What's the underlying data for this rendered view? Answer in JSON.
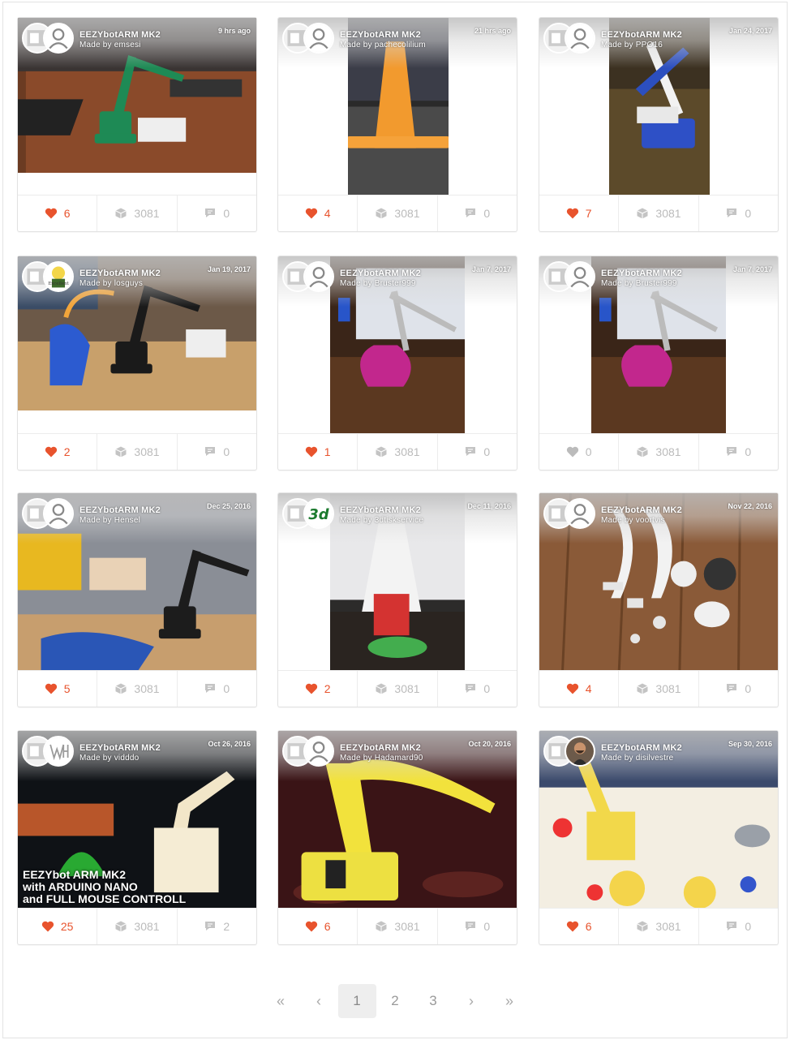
{
  "colors": {
    "accent": "#e8532d",
    "muted": "#bbbbbb"
  },
  "makes": [
    {
      "thing": "EEZYbotARM MK2",
      "maker": "Made by emsesi",
      "date": "9 hrs ago",
      "likes": "6",
      "views": "3081",
      "comments": "0",
      "liked": true,
      "avatar": "default-user-avatar"
    },
    {
      "thing": "EEZYbotARM MK2",
      "maker": "Made by pachecolilium",
      "date": "21 hrs ago",
      "likes": "4",
      "views": "3081",
      "comments": "0",
      "liked": true,
      "avatar": "default-user-avatar"
    },
    {
      "thing": "EEZYbotARM MK2",
      "maker": "Made by PPO16",
      "date": "Jan 24, 2017",
      "likes": "7",
      "views": "3081",
      "comments": "0",
      "liked": true,
      "avatar": "default-user-avatar"
    },
    {
      "thing": "EEZYbotARM MK2",
      "maker": "Made by losguys",
      "date": "Jan 19, 2017",
      "likes": "2",
      "views": "3081",
      "comments": "0",
      "liked": true,
      "avatar": "cartoon-avatar",
      "avatar_caption": "Excellent"
    },
    {
      "thing": "EEZYbotARM MK2",
      "maker": "Made by Bruster999",
      "date": "Jan 7, 2017",
      "likes": "1",
      "views": "3081",
      "comments": "0",
      "liked": true,
      "avatar": "default-user-avatar"
    },
    {
      "thing": "EEZYbotARM MK2",
      "maker": "Made by Bruster999",
      "date": "Jan 7, 2017",
      "likes": "0",
      "views": "3081",
      "comments": "0",
      "liked": false,
      "avatar": "default-user-avatar"
    },
    {
      "thing": "EEZYbotARM MK2",
      "maker": "Made by Hensel",
      "date": "Dec 25, 2016",
      "likes": "5",
      "views": "3081",
      "comments": "0",
      "liked": true,
      "avatar": "default-user-avatar"
    },
    {
      "thing": "EEZYbotARM MK2",
      "maker": "Made by 3dtiskservice",
      "date": "Dec 11, 2016",
      "likes": "2",
      "views": "3081",
      "comments": "0",
      "liked": true,
      "avatar": "3d-logo-avatar",
      "avatar_caption": "3d"
    },
    {
      "thing": "EEZYbotARM MK2",
      "maker": "Made by voortvis",
      "date": "Nov 22, 2016",
      "likes": "4",
      "views": "3081",
      "comments": "0",
      "liked": true,
      "avatar": "default-user-avatar"
    },
    {
      "thing": "EEZYbotARM MK2",
      "maker": "Made by vidddo",
      "date": "Oct 26, 2016",
      "likes": "25",
      "views": "3081",
      "comments": "2",
      "liked": true,
      "avatar": "wh-logo-avatar",
      "caption": [
        "EEZYbot ARM MK2",
        "with ARDUINO NANO",
        "and FULL MOUSE CONTROLL"
      ]
    },
    {
      "thing": "EEZYbotARM MK2",
      "maker": "Made by Hadamard90",
      "date": "Oct 20, 2016",
      "likes": "6",
      "views": "3081",
      "comments": "0",
      "liked": true,
      "avatar": "default-user-avatar"
    },
    {
      "thing": "EEZYbotARM MK2",
      "maker": "Made by disilvestre",
      "date": "Sep 30, 2016",
      "likes": "6",
      "views": "3081",
      "comments": "0",
      "liked": true,
      "avatar": "photo-avatar"
    }
  ],
  "pagination": {
    "first": "«",
    "prev": "‹",
    "pages": [
      "1",
      "2",
      "3"
    ],
    "current": "1",
    "next": "›",
    "last": "»"
  }
}
